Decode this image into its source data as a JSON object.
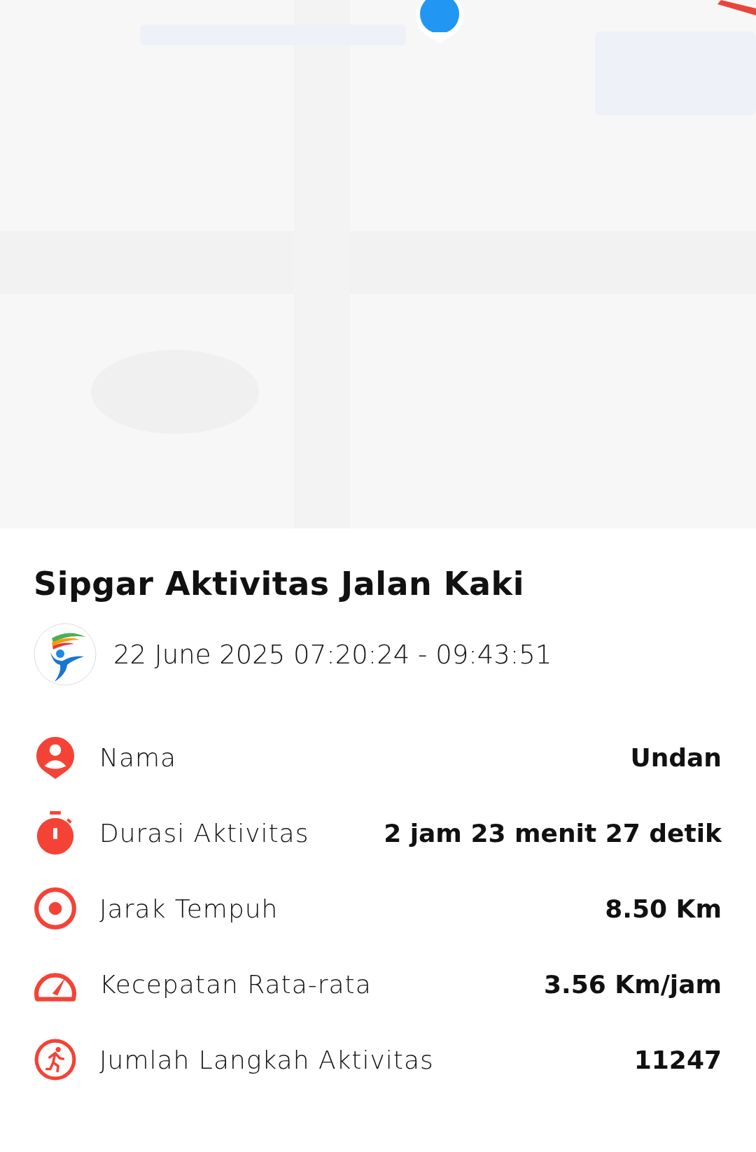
{
  "title": "Sipgar Aktivitas Jalan Kaki",
  "date_range": "22 June 2025 07:20:24 - 09:43:51",
  "stats": [
    {
      "kind": "person",
      "label": "Nama",
      "value": "Undan"
    },
    {
      "kind": "timer",
      "label": "Durasi Aktivitas",
      "value": "2 jam 23 menit 27 detik"
    },
    {
      "kind": "target",
      "label": "Jarak Tempuh",
      "value": "8.50 Km"
    },
    {
      "kind": "speed",
      "label": "Kecepatan Rata-rata",
      "value": "3.56 Km/jam"
    },
    {
      "kind": "run",
      "label": "Jumlah Langkah Aktivitas",
      "value": "11247"
    }
  ]
}
